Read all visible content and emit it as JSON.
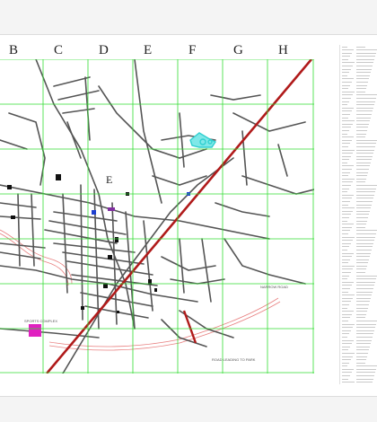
{
  "map": {
    "column_labels": [
      "B",
      "C",
      "D",
      "E",
      "F",
      "G",
      "H"
    ],
    "feature_labels": {
      "road_label": "NARROW ROAD",
      "bottom_label": "ROAD LEADING TO PARK",
      "block_label": "",
      "top_small_1": "",
      "top_small_2": "",
      "pink_label": "SPORTS COMPLEX"
    },
    "colors": {
      "grid": "#33dd33",
      "road": "#555555",
      "railway": "#b01a1a",
      "river": "#e88080",
      "highlight_pink": "#e020c0",
      "teal_feature": "#30d0d0",
      "landmark_blue": "#2040d0",
      "landmark_purple": "#8030a0",
      "building": "#111111"
    }
  },
  "legend": {
    "row_count": 105
  }
}
